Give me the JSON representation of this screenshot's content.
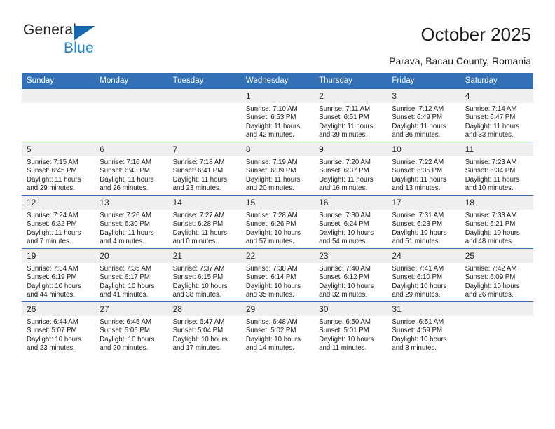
{
  "brand": {
    "name_top": "General",
    "name_bottom": "Blue"
  },
  "header": {
    "title": "October 2025",
    "subtitle": "Parava, Bacau County, Romania"
  },
  "colors": {
    "header_blue": "#3370b5",
    "logo_triangle": "#1868b0",
    "logo_blue_text": "#1b87d6",
    "daynum_band": "#efefef",
    "text": "#1a1a1a"
  },
  "weekday_headers": [
    "Sunday",
    "Monday",
    "Tuesday",
    "Wednesday",
    "Thursday",
    "Friday",
    "Saturday"
  ],
  "weeks": [
    [
      {
        "day": "",
        "blank": true,
        "sunrise": "",
        "sunset": "",
        "daylight1": "",
        "daylight2": ""
      },
      {
        "day": "",
        "blank": true,
        "sunrise": "",
        "sunset": "",
        "daylight1": "",
        "daylight2": ""
      },
      {
        "day": "",
        "blank": true,
        "sunrise": "",
        "sunset": "",
        "daylight1": "",
        "daylight2": ""
      },
      {
        "day": "1",
        "blank": false,
        "sunrise": "Sunrise: 7:10 AM",
        "sunset": "Sunset: 6:53 PM",
        "daylight1": "Daylight: 11 hours",
        "daylight2": "and 42 minutes."
      },
      {
        "day": "2",
        "blank": false,
        "sunrise": "Sunrise: 7:11 AM",
        "sunset": "Sunset: 6:51 PM",
        "daylight1": "Daylight: 11 hours",
        "daylight2": "and 39 minutes."
      },
      {
        "day": "3",
        "blank": false,
        "sunrise": "Sunrise: 7:12 AM",
        "sunset": "Sunset: 6:49 PM",
        "daylight1": "Daylight: 11 hours",
        "daylight2": "and 36 minutes."
      },
      {
        "day": "4",
        "blank": false,
        "sunrise": "Sunrise: 7:14 AM",
        "sunset": "Sunset: 6:47 PM",
        "daylight1": "Daylight: 11 hours",
        "daylight2": "and 33 minutes."
      }
    ],
    [
      {
        "day": "5",
        "blank": false,
        "sunrise": "Sunrise: 7:15 AM",
        "sunset": "Sunset: 6:45 PM",
        "daylight1": "Daylight: 11 hours",
        "daylight2": "and 29 minutes."
      },
      {
        "day": "6",
        "blank": false,
        "sunrise": "Sunrise: 7:16 AM",
        "sunset": "Sunset: 6:43 PM",
        "daylight1": "Daylight: 11 hours",
        "daylight2": "and 26 minutes."
      },
      {
        "day": "7",
        "blank": false,
        "sunrise": "Sunrise: 7:18 AM",
        "sunset": "Sunset: 6:41 PM",
        "daylight1": "Daylight: 11 hours",
        "daylight2": "and 23 minutes."
      },
      {
        "day": "8",
        "blank": false,
        "sunrise": "Sunrise: 7:19 AM",
        "sunset": "Sunset: 6:39 PM",
        "daylight1": "Daylight: 11 hours",
        "daylight2": "and 20 minutes."
      },
      {
        "day": "9",
        "blank": false,
        "sunrise": "Sunrise: 7:20 AM",
        "sunset": "Sunset: 6:37 PM",
        "daylight1": "Daylight: 11 hours",
        "daylight2": "and 16 minutes."
      },
      {
        "day": "10",
        "blank": false,
        "sunrise": "Sunrise: 7:22 AM",
        "sunset": "Sunset: 6:35 PM",
        "daylight1": "Daylight: 11 hours",
        "daylight2": "and 13 minutes."
      },
      {
        "day": "11",
        "blank": false,
        "sunrise": "Sunrise: 7:23 AM",
        "sunset": "Sunset: 6:34 PM",
        "daylight1": "Daylight: 11 hours",
        "daylight2": "and 10 minutes."
      }
    ],
    [
      {
        "day": "12",
        "blank": false,
        "sunrise": "Sunrise: 7:24 AM",
        "sunset": "Sunset: 6:32 PM",
        "daylight1": "Daylight: 11 hours",
        "daylight2": "and 7 minutes."
      },
      {
        "day": "13",
        "blank": false,
        "sunrise": "Sunrise: 7:26 AM",
        "sunset": "Sunset: 6:30 PM",
        "daylight1": "Daylight: 11 hours",
        "daylight2": "and 4 minutes."
      },
      {
        "day": "14",
        "blank": false,
        "sunrise": "Sunrise: 7:27 AM",
        "sunset": "Sunset: 6:28 PM",
        "daylight1": "Daylight: 11 hours",
        "daylight2": "and 0 minutes."
      },
      {
        "day": "15",
        "blank": false,
        "sunrise": "Sunrise: 7:28 AM",
        "sunset": "Sunset: 6:26 PM",
        "daylight1": "Daylight: 10 hours",
        "daylight2": "and 57 minutes."
      },
      {
        "day": "16",
        "blank": false,
        "sunrise": "Sunrise: 7:30 AM",
        "sunset": "Sunset: 6:24 PM",
        "daylight1": "Daylight: 10 hours",
        "daylight2": "and 54 minutes."
      },
      {
        "day": "17",
        "blank": false,
        "sunrise": "Sunrise: 7:31 AM",
        "sunset": "Sunset: 6:23 PM",
        "daylight1": "Daylight: 10 hours",
        "daylight2": "and 51 minutes."
      },
      {
        "day": "18",
        "blank": false,
        "sunrise": "Sunrise: 7:33 AM",
        "sunset": "Sunset: 6:21 PM",
        "daylight1": "Daylight: 10 hours",
        "daylight2": "and 48 minutes."
      }
    ],
    [
      {
        "day": "19",
        "blank": false,
        "sunrise": "Sunrise: 7:34 AM",
        "sunset": "Sunset: 6:19 PM",
        "daylight1": "Daylight: 10 hours",
        "daylight2": "and 44 minutes."
      },
      {
        "day": "20",
        "blank": false,
        "sunrise": "Sunrise: 7:35 AM",
        "sunset": "Sunset: 6:17 PM",
        "daylight1": "Daylight: 10 hours",
        "daylight2": "and 41 minutes."
      },
      {
        "day": "21",
        "blank": false,
        "sunrise": "Sunrise: 7:37 AM",
        "sunset": "Sunset: 6:15 PM",
        "daylight1": "Daylight: 10 hours",
        "daylight2": "and 38 minutes."
      },
      {
        "day": "22",
        "blank": false,
        "sunrise": "Sunrise: 7:38 AM",
        "sunset": "Sunset: 6:14 PM",
        "daylight1": "Daylight: 10 hours",
        "daylight2": "and 35 minutes."
      },
      {
        "day": "23",
        "blank": false,
        "sunrise": "Sunrise: 7:40 AM",
        "sunset": "Sunset: 6:12 PM",
        "daylight1": "Daylight: 10 hours",
        "daylight2": "and 32 minutes."
      },
      {
        "day": "24",
        "blank": false,
        "sunrise": "Sunrise: 7:41 AM",
        "sunset": "Sunset: 6:10 PM",
        "daylight1": "Daylight: 10 hours",
        "daylight2": "and 29 minutes."
      },
      {
        "day": "25",
        "blank": false,
        "sunrise": "Sunrise: 7:42 AM",
        "sunset": "Sunset: 6:09 PM",
        "daylight1": "Daylight: 10 hours",
        "daylight2": "and 26 minutes."
      }
    ],
    [
      {
        "day": "26",
        "blank": false,
        "sunrise": "Sunrise: 6:44 AM",
        "sunset": "Sunset: 5:07 PM",
        "daylight1": "Daylight: 10 hours",
        "daylight2": "and 23 minutes."
      },
      {
        "day": "27",
        "blank": false,
        "sunrise": "Sunrise: 6:45 AM",
        "sunset": "Sunset: 5:05 PM",
        "daylight1": "Daylight: 10 hours",
        "daylight2": "and 20 minutes."
      },
      {
        "day": "28",
        "blank": false,
        "sunrise": "Sunrise: 6:47 AM",
        "sunset": "Sunset: 5:04 PM",
        "daylight1": "Daylight: 10 hours",
        "daylight2": "and 17 minutes."
      },
      {
        "day": "29",
        "blank": false,
        "sunrise": "Sunrise: 6:48 AM",
        "sunset": "Sunset: 5:02 PM",
        "daylight1": "Daylight: 10 hours",
        "daylight2": "and 14 minutes."
      },
      {
        "day": "30",
        "blank": false,
        "sunrise": "Sunrise: 6:50 AM",
        "sunset": "Sunset: 5:01 PM",
        "daylight1": "Daylight: 10 hours",
        "daylight2": "and 11 minutes."
      },
      {
        "day": "31",
        "blank": false,
        "sunrise": "Sunrise: 6:51 AM",
        "sunset": "Sunset: 4:59 PM",
        "daylight1": "Daylight: 10 hours",
        "daylight2": "and 8 minutes."
      },
      {
        "day": "",
        "blank": true,
        "sunrise": "",
        "sunset": "",
        "daylight1": "",
        "daylight2": ""
      }
    ]
  ]
}
